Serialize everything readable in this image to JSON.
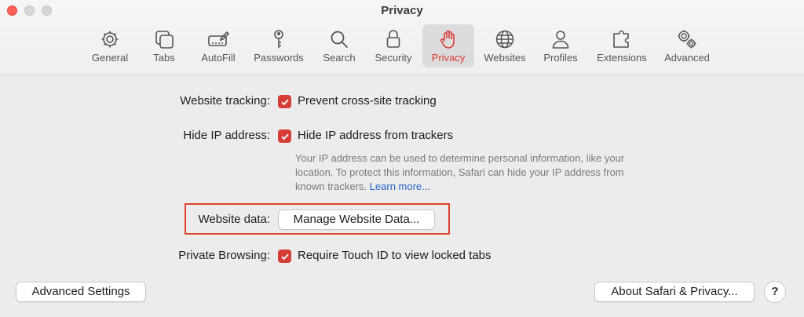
{
  "window": {
    "title": "Privacy"
  },
  "toolbar": {
    "items": [
      {
        "label": "General",
        "icon": "gear-icon"
      },
      {
        "label": "Tabs",
        "icon": "tabs-icon"
      },
      {
        "label": "AutoFill",
        "icon": "autofill-icon"
      },
      {
        "label": "Passwords",
        "icon": "key-icon"
      },
      {
        "label": "Search",
        "icon": "magnifier-icon"
      },
      {
        "label": "Security",
        "icon": "lock-icon"
      },
      {
        "label": "Privacy",
        "icon": "hand-icon"
      },
      {
        "label": "Websites",
        "icon": "globe-icon"
      },
      {
        "label": "Profiles",
        "icon": "person-icon"
      },
      {
        "label": "Extensions",
        "icon": "puzzle-icon"
      },
      {
        "label": "Advanced",
        "icon": "gears-icon"
      }
    ],
    "active": "Privacy"
  },
  "privacy": {
    "website_tracking_label": "Website tracking:",
    "prevent_tracking_text": "Prevent cross-site tracking",
    "hide_ip_label": "Hide IP address:",
    "hide_ip_text": "Hide IP address from trackers",
    "hide_ip_description": "Your IP address can be used to determine personal information, like your location. To protect this information, Safari can hide your IP address from known trackers.",
    "learn_more": "Learn more...",
    "website_data_label": "Website data:",
    "manage_button": "Manage Website Data...",
    "private_browsing_label": "Private Browsing:",
    "touch_id_text": "Require Touch ID to view locked tabs"
  },
  "footer": {
    "advanced_settings_button": "Advanced Settings",
    "about_button": "About Safari & Privacy...",
    "help_button": "?"
  },
  "colors": {
    "accent": "#d63d36",
    "highlight_border": "#e0442c",
    "link": "#2a62c9"
  }
}
